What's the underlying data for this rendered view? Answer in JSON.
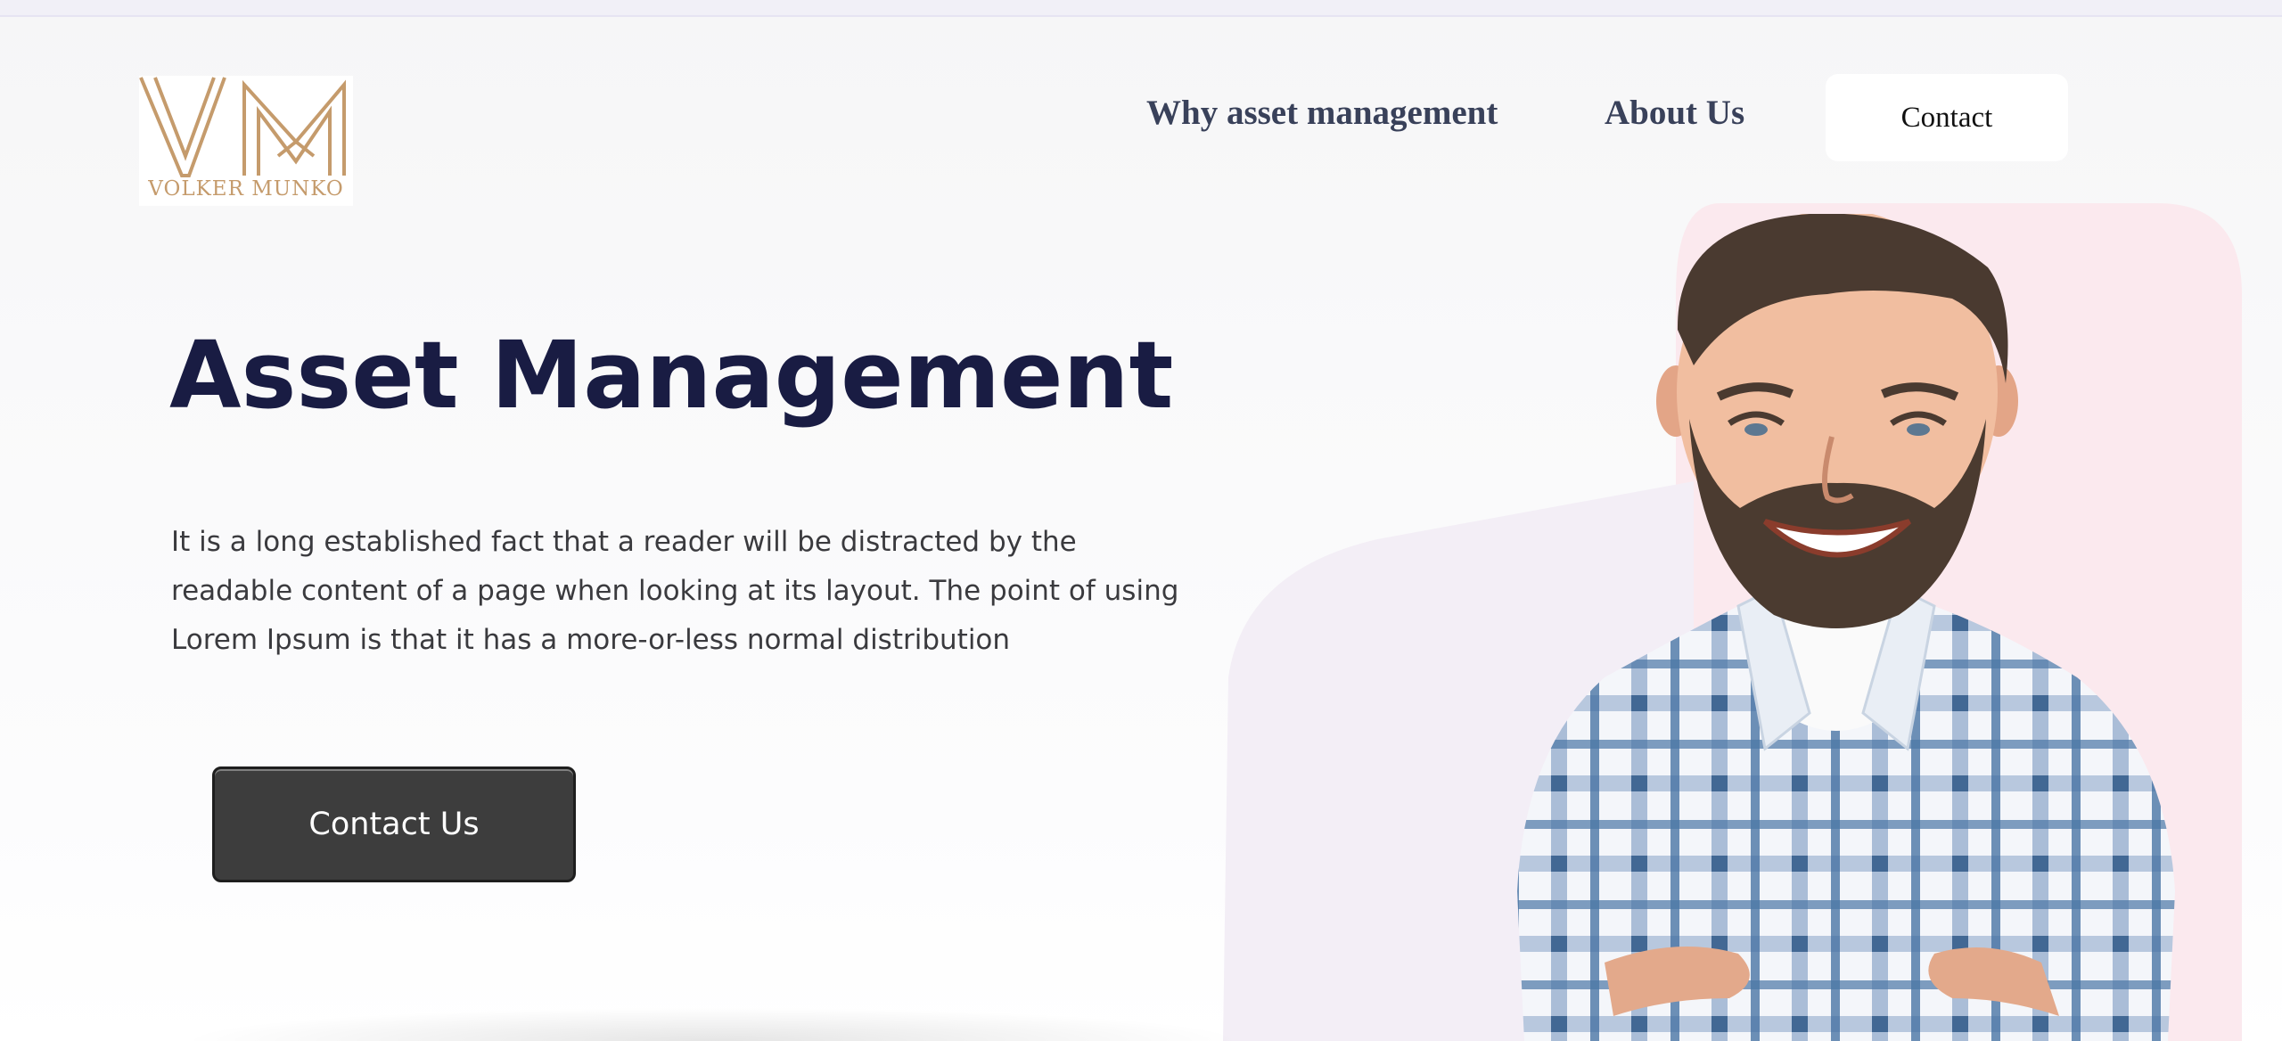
{
  "header": {
    "logo": {
      "monogram": "VM",
      "name": "VOLKER MUNKO",
      "color": "#c59b6c"
    },
    "nav": {
      "why": "Why asset management",
      "about": "About Us",
      "contact": "Contact"
    }
  },
  "hero": {
    "title": "Asset Management",
    "description": "It is a long established fact that a reader will be distracted by the readable content of a page when looking at its layout. The point of using Lorem Ipsum is that it has a more-or-less normal distribution",
    "button_label": "Contact Us",
    "image": "smiling-man-in-plaid-shirt-photo"
  },
  "colors": {
    "title": "#191c43",
    "button_bg": "#3d3d3d",
    "nav_text": "#39415a",
    "accent_pink": "#fbe9ee",
    "accent_lilac": "#f3eef6"
  }
}
